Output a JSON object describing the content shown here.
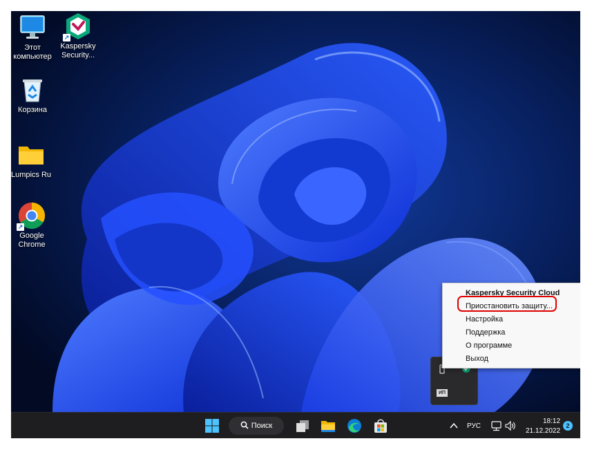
{
  "desktop": {
    "icons": [
      {
        "label_line1": "Этот",
        "label_line2": "компьютер",
        "icon": "monitor-icon"
      },
      {
        "label_line1": "Kaspersky",
        "label_line2": "Security...",
        "icon": "kaspersky-icon"
      },
      {
        "label_line1": "Корзина",
        "label_line2": "",
        "icon": "recycle-bin-icon"
      },
      {
        "label_line1": "Lumpics Ru",
        "label_line2": "",
        "icon": "folder-icon"
      },
      {
        "label_line1": "Google",
        "label_line2": "Chrome",
        "icon": "chrome-icon"
      }
    ]
  },
  "context_menu": {
    "title": "Kaspersky Security Cloud",
    "items": [
      "Приостановить защиту...",
      "Настройка",
      "Поддержка",
      "О программе",
      "Выход"
    ]
  },
  "taskbar": {
    "search_label": "Поиск",
    "language": "РУС",
    "time": "18:12",
    "date": "21.12.2022",
    "notification_count": "2"
  },
  "tray_flyout": {
    "app_label": "ИП"
  },
  "colors": {
    "highlight": "#e00000",
    "wallpaper_blue": "#1e4bff",
    "taskbar": "#1e1e20"
  }
}
